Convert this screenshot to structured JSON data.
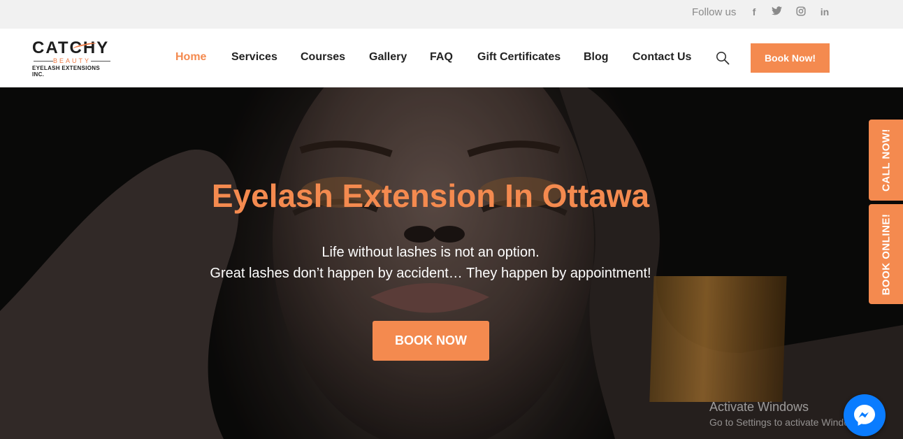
{
  "topbar": {
    "follow_label": "Follow us",
    "social_icons": [
      "facebook-icon",
      "twitter-icon",
      "instagram-icon",
      "linkedin-icon"
    ],
    "facebook_glyph": "f",
    "linkedin_glyph": "in"
  },
  "logo": {
    "main": "CATCHY",
    "sub": "BEAUTY",
    "tagline": "EYELASH EXTENSIONS INC."
  },
  "nav": {
    "items": [
      {
        "label": "Home",
        "active": true
      },
      {
        "label": "Services"
      },
      {
        "label": "Courses"
      },
      {
        "label": "Gallery"
      },
      {
        "label": "FAQ"
      },
      {
        "label": "Gift Certificates"
      },
      {
        "label": "Blog"
      },
      {
        "label": "Contact Us"
      }
    ],
    "search_icon": "search-icon",
    "book_label": "Book Now!"
  },
  "hero": {
    "title": "Eyelash Extension In Ottawa",
    "line1": "Life without lashes is not an option.",
    "line2": "Great lashes don’t happen by accident… They happen by appointment!",
    "button_label": "BOOK NOW"
  },
  "side_tabs": {
    "call": "CALL NOW!",
    "book": "BOOK ONLINE!"
  },
  "watermark": {
    "title": "Activate Windows",
    "subtitle": "Go to Settings to activate Windows."
  },
  "messenger": {
    "icon": "messenger-icon"
  },
  "colors": {
    "accent": "#f48a4f",
    "topbar_bg": "#f1f1f1",
    "nav_text": "#222222",
    "messenger": "#0a7cff"
  }
}
